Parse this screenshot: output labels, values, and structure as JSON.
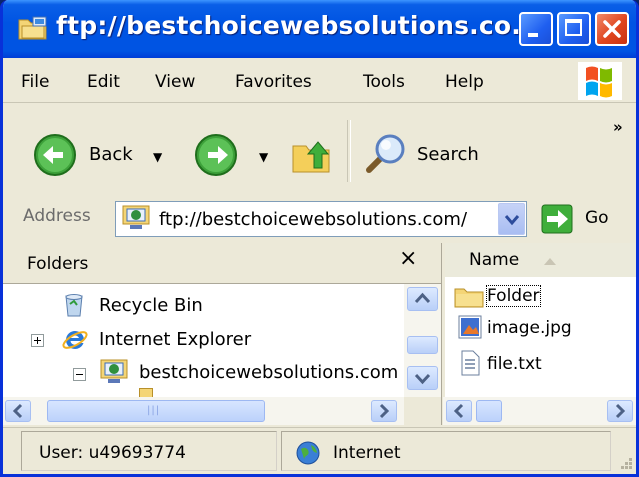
{
  "window": {
    "title": "ftp://bestchoicewebsolutions.co...",
    "icon": "ftp-folder-icon"
  },
  "menubar": {
    "items": [
      "File",
      "Edit",
      "View",
      "Favorites",
      "Tools",
      "Help"
    ]
  },
  "toolbar": {
    "back_label": "Back",
    "search_label": "Search",
    "overflow": "»"
  },
  "address": {
    "label": "Address",
    "value": "ftp://bestchoicewebsolutions.com/",
    "go_label": "Go"
  },
  "folders": {
    "title": "Folders",
    "close": "×",
    "items": [
      {
        "label": "Recycle Bin",
        "icon": "recycle-bin-icon"
      },
      {
        "label": "Internet Explorer",
        "icon": "internet-explorer-icon"
      },
      {
        "label": "bestchoicewebsolutions.com",
        "icon": "ftp-site-icon"
      }
    ]
  },
  "filelist": {
    "column": "Name",
    "items": [
      {
        "label": "Folder",
        "icon": "folder-icon"
      },
      {
        "label": "image.jpg",
        "icon": "image-file-icon"
      },
      {
        "label": "file.txt",
        "icon": "text-file-icon"
      }
    ]
  },
  "status": {
    "user": "User: u49693774",
    "zone": "Internet"
  },
  "colors": {
    "titlebar": "#0054e3",
    "chrome": "#ece9d8",
    "close_button": "#e0461f"
  }
}
